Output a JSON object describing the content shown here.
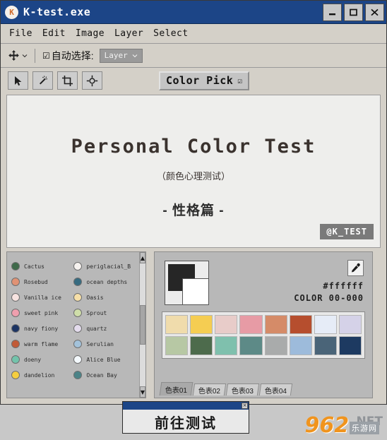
{
  "window": {
    "title": "K-test.exe",
    "app_icon": "app-icon",
    "controls": {
      "minimize": "minimize-icon",
      "maximize": "maximize-icon",
      "close": "close-icon"
    }
  },
  "menubar": {
    "items": [
      {
        "label": "File"
      },
      {
        "label": "Edit"
      },
      {
        "label": "Image"
      },
      {
        "label": "Layer"
      },
      {
        "label": "Select"
      }
    ]
  },
  "optionsbar": {
    "move_tool_icon": "move-tool-icon",
    "move_tool_caret": "chevron-down-icon",
    "autoselect_checkbox": "☑",
    "autoselect_label": "自动选择:",
    "layer_dropdown": {
      "value": "Layer",
      "caret": "chevron-down-icon"
    }
  },
  "toolbar": {
    "tools": [
      {
        "name": "pointer-tool",
        "icon": "pointer-icon"
      },
      {
        "name": "magic-wand-tool",
        "icon": "magic-wand-icon"
      },
      {
        "name": "crop-tool",
        "icon": "crop-icon"
      },
      {
        "name": "move-target-tool",
        "icon": "move-target-icon"
      }
    ],
    "color_pick": {
      "label": "Color Pick",
      "caret": "☑"
    }
  },
  "canvas": {
    "title": "Personal Color Test",
    "subtitle": "（颜色心理测试）",
    "section": "- 性格篇 -",
    "badge": "@K_TEST"
  },
  "swatch_panel": {
    "scrollbar": {
      "up": "▲",
      "down": "▼"
    },
    "items": [
      {
        "name": "Cactus",
        "color": "#3f6a4a"
      },
      {
        "name": "periglacial_B",
        "color": "#f6f2ef"
      },
      {
        "name": "Rosebud",
        "color": "#e09274"
      },
      {
        "name": "ocean depths",
        "color": "#366b80"
      },
      {
        "name": "Vanilla ice",
        "color": "#f7e3e0"
      },
      {
        "name": "Oasis",
        "color": "#f6dfa8"
      },
      {
        "name": "sweet pink",
        "color": "#ef9fae"
      },
      {
        "name": "Sprout",
        "color": "#cfdea9"
      },
      {
        "name": "navy fiony",
        "color": "#1c3463"
      },
      {
        "name": "quartz",
        "color": "#e4dced"
      },
      {
        "name": "warm flame",
        "color": "#c15a37"
      },
      {
        "name": "Serulian",
        "color": "#a3c2da"
      },
      {
        "name": "doeny",
        "color": "#73c3ab"
      },
      {
        "name": "Alice Blue",
        "color": "#f4f9fd"
      },
      {
        "name": "dandelion",
        "color": "#f5ce3f"
      },
      {
        "name": "Ocean Bay",
        "color": "#4b8387"
      }
    ]
  },
  "picker_panel": {
    "foreground_color": "#262626",
    "background_color": "#ffffff",
    "eyedropper_icon": "eyedropper-icon",
    "hex_value": "#ffffff",
    "color_index": "COLOR 00-000",
    "palette_rows": [
      [
        "#f0dcac",
        "#f5cd52",
        "#e8ccc9",
        "#e79ba5",
        "#d58b68",
        "#b64e2e",
        "#e6ecf7",
        "#d5d2e8"
      ],
      [
        "#b7c8a4",
        "#4d6b4c",
        "#7fc0ad",
        "#5d8a87",
        "#a9abab",
        "#9dbbdb",
        "#4a6478",
        "#1d3a61"
      ]
    ],
    "tabs": [
      {
        "label": "色表01",
        "active": true
      },
      {
        "label": "色表02",
        "active": false
      },
      {
        "label": "色表03",
        "active": false
      },
      {
        "label": "色表04",
        "active": false
      }
    ]
  },
  "modal": {
    "close_icon": "×",
    "button_label": "前往测试"
  },
  "watermark": {
    "number": "962",
    "net": ".NET",
    "cn": "乐游网"
  }
}
